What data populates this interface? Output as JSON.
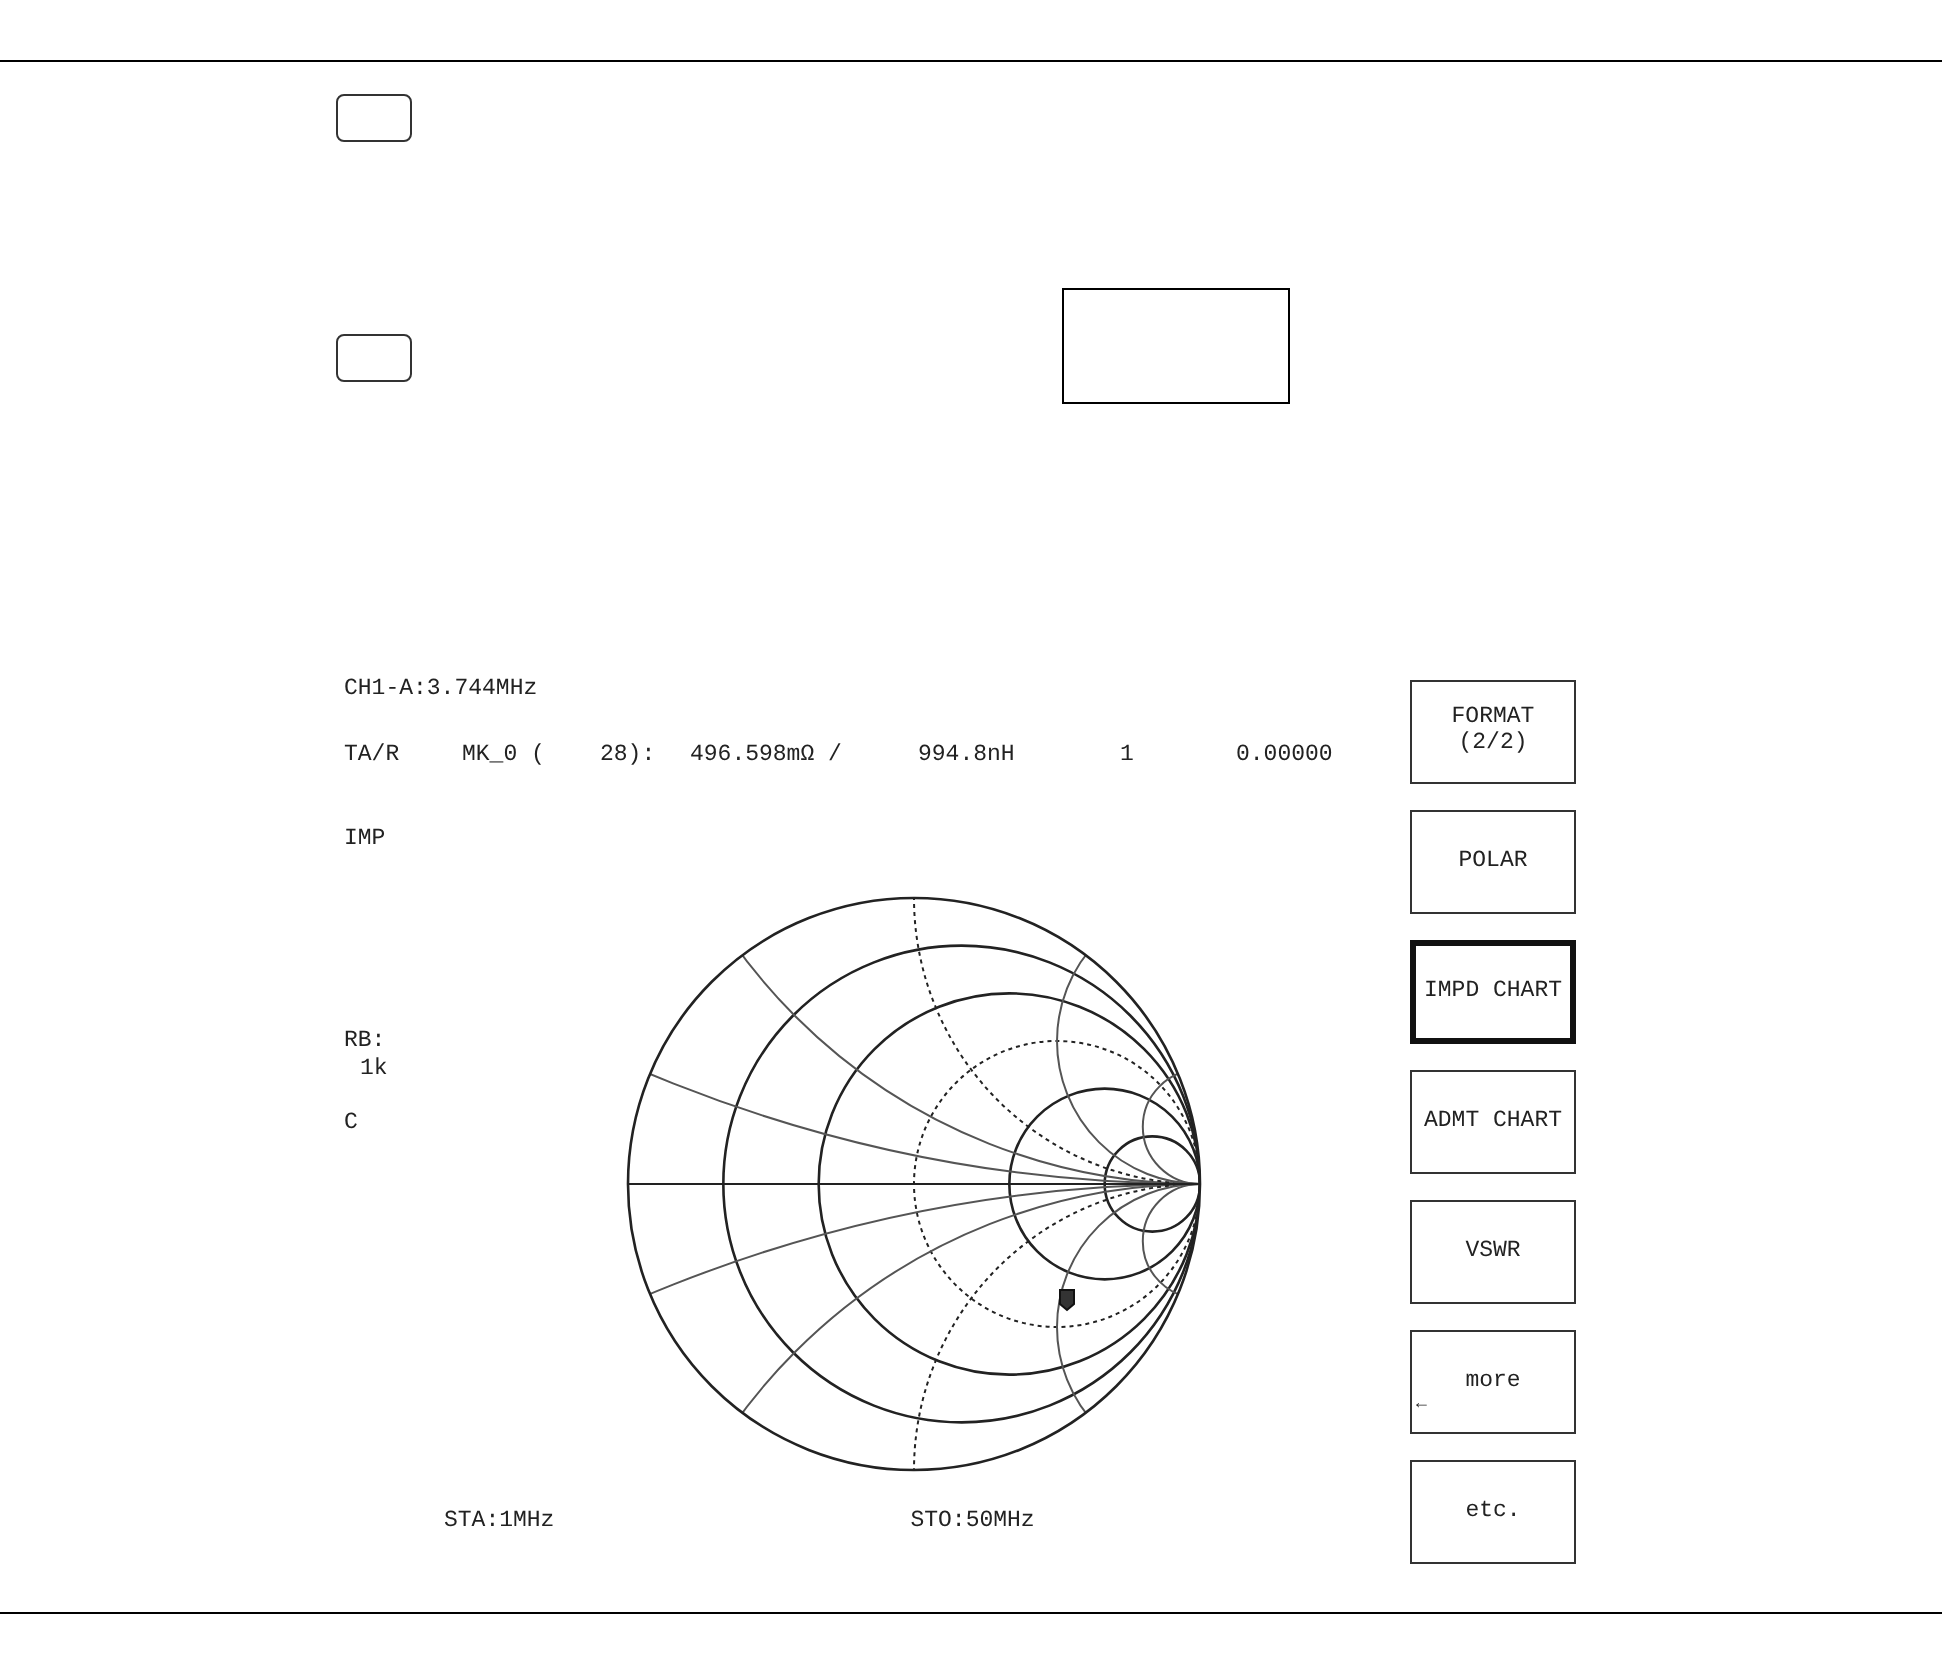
{
  "screen": {
    "channel": "CH1-A:3.744MHz",
    "marker_readout": [
      "TA/R",
      "MK_0 (",
      "28):",
      "496.598mΩ /",
      "994.8nH",
      "1",
      "0.00000"
    ],
    "format": "IMP",
    "ref_label": "RB:",
    "ref_value": "1k",
    "cal_flag": "C",
    "start": "STA:1MHz",
    "stop": "STO:50MHz"
  },
  "softkeys": [
    {
      "label": "FORMAT",
      "sublabel": "(2/2)",
      "selected": false
    },
    {
      "label": "POLAR",
      "selected": false
    },
    {
      "label": "IMPD CHART",
      "selected": true
    },
    {
      "label": "ADMT CHART",
      "selected": false
    },
    {
      "label": "VSWR",
      "selected": false
    },
    {
      "label": "more",
      "arrow": "←",
      "selected": false
    },
    {
      "label": "etc.",
      "selected": false
    }
  ]
}
